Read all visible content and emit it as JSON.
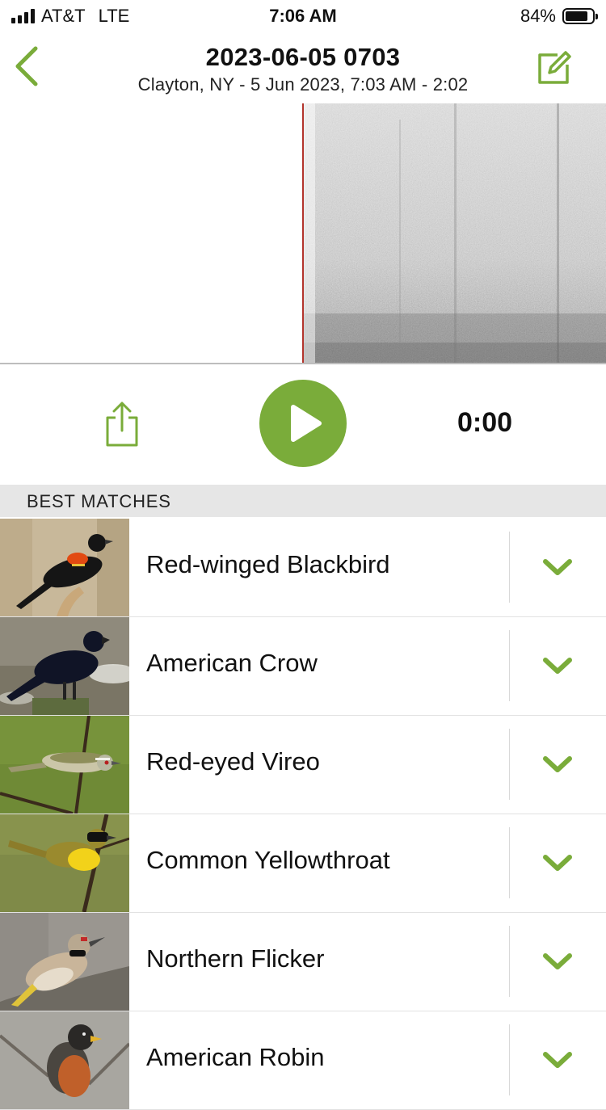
{
  "status_bar": {
    "carrier": "AT&T",
    "network": "LTE",
    "time": "7:06 AM",
    "battery_percent": "84%",
    "battery_level": 0.84
  },
  "header": {
    "title": "2023-06-05 0703",
    "subtitle": "Clayton, NY - 5 Jun 2023, 7:03 AM - 2:02"
  },
  "icons": {
    "back": "chevron-left-icon",
    "edit": "edit-square-icon",
    "share": "share-icon",
    "play": "play-icon",
    "expand": "chevron-down-icon"
  },
  "player": {
    "elapsed": "0:00"
  },
  "matches_header": "BEST MATCHES",
  "matches": [
    {
      "name": "Red-winged Blackbird"
    },
    {
      "name": "American Crow"
    },
    {
      "name": "Red-eyed Vireo"
    },
    {
      "name": "Common Yellowthroat"
    },
    {
      "name": "Northern Flicker"
    },
    {
      "name": "American Robin"
    }
  ],
  "colors": {
    "accent": "#7aac3a",
    "playhead": "#b3342c",
    "section_bg": "#e6e6e6"
  }
}
